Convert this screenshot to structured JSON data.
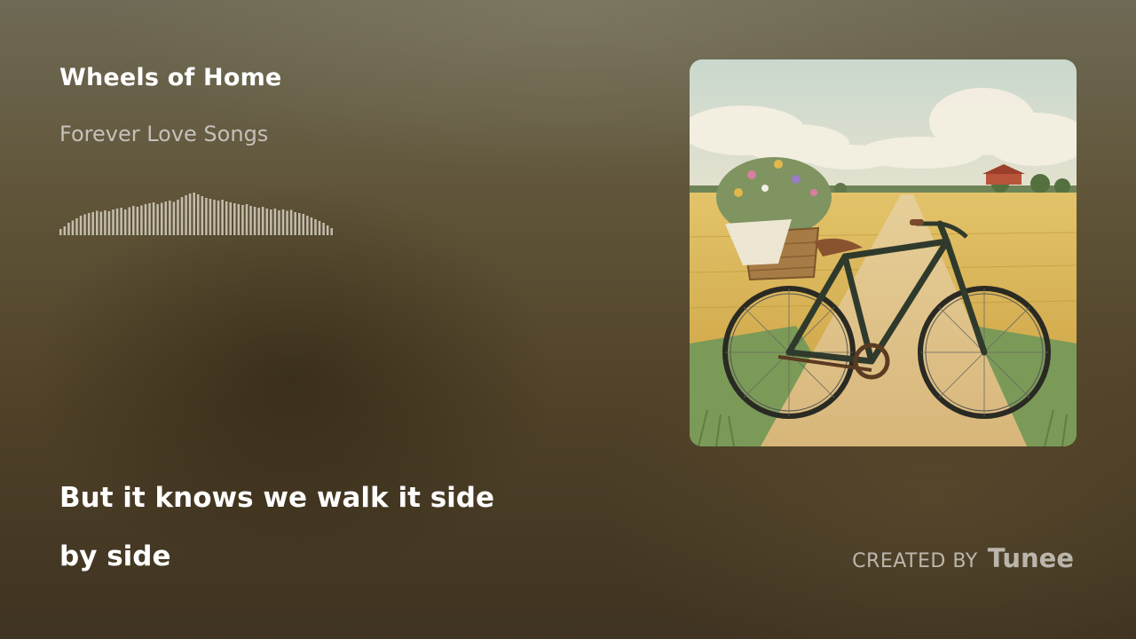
{
  "track": {
    "title": "Wheels of Home",
    "album": "Forever Love Songs"
  },
  "waveform": {
    "levels": [
      0.14,
      0.2,
      0.28,
      0.33,
      0.38,
      0.44,
      0.47,
      0.5,
      0.52,
      0.55,
      0.53,
      0.56,
      0.54,
      0.58,
      0.6,
      0.62,
      0.58,
      0.63,
      0.66,
      0.64,
      0.67,
      0.7,
      0.72,
      0.74,
      0.7,
      0.73,
      0.76,
      0.78,
      0.75,
      0.8,
      0.86,
      0.9,
      0.94,
      0.96,
      0.92,
      0.88,
      0.84,
      0.82,
      0.8,
      0.78,
      0.8,
      0.76,
      0.74,
      0.72,
      0.7,
      0.68,
      0.7,
      0.66,
      0.64,
      0.62,
      0.64,
      0.6,
      0.58,
      0.6,
      0.56,
      0.58,
      0.55,
      0.57,
      0.52,
      0.5,
      0.48,
      0.44,
      0.4,
      0.36,
      0.32,
      0.28,
      0.22,
      0.16
    ],
    "color": "#d6d0c2"
  },
  "lyrics": {
    "line1": "But it knows we walk it side",
    "line2": "by side"
  },
  "cover_art": {
    "description_icon": "album-cover-bicycle"
  },
  "credit": {
    "prefix": "CREATED BY",
    "brand": "Tunee"
  }
}
